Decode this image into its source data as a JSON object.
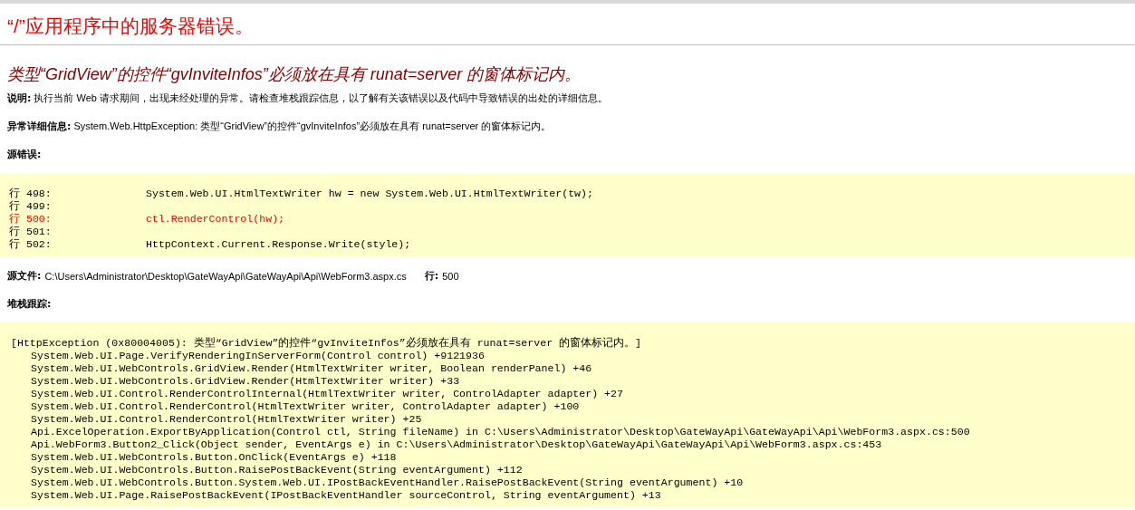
{
  "title": "“/”应用程序中的服务器错误。",
  "message": "类型“GridView”的控件“gvInviteInfos”必须放在具有 runat=server 的窗体标记内。",
  "description": {
    "label": "说明:",
    "text": "执行当前 Web 请求期间，出现未经处理的异常。请检查堆栈跟踪信息，以了解有关该错误以及代码中导致错误的出处的详细信息。"
  },
  "exception_details": {
    "label": "异常详细信息:",
    "text": "System.Web.HttpException: 类型“GridView”的控件“gvInviteInfos”必须放在具有 runat=server 的窗体标记内。"
  },
  "source_error": {
    "label": "源错误:",
    "lines": [
      {
        "number": "行 498:",
        "code": "System.Web.UI.HtmlTextWriter hw = new System.Web.UI.HtmlTextWriter(tw);",
        "highlighted": false
      },
      {
        "number": "行 499:",
        "highlighted": false
      },
      {
        "number": "行 500:",
        "code": "ctl.RenderControl(hw);",
        "highlighted": true
      },
      {
        "number": "行 501:",
        "highlighted": false
      },
      {
        "number": "行 502:",
        "code": "HttpContext.Current.Response.Write(style);",
        "highlighted": false
      }
    ]
  },
  "source_file": {
    "label": "源文件:",
    "path": "C:\\Users\\Administrator\\Desktop\\GateWayApi\\GateWayApi\\Api\\WebForm3.aspx.cs",
    "line_label": "行:",
    "line": "500"
  },
  "stack_trace": {
    "label": "堆栈跟踪:",
    "header": "[HttpException (0x80004005): 类型“GridView”的控件“gvInviteInfos”必须放在具有 runat=server 的窗体标记内。]",
    "frames": [
      "System.Web.UI.Page.VerifyRenderingInServerForm(Control control) +9121936",
      "System.Web.UI.WebControls.GridView.Render(HtmlTextWriter writer, Boolean renderPanel) +46",
      "System.Web.UI.WebControls.GridView.Render(HtmlTextWriter writer) +33",
      "System.Web.UI.Control.RenderControlInternal(HtmlTextWriter writer, ControlAdapter adapter) +27",
      "System.Web.UI.Control.RenderControl(HtmlTextWriter writer, ControlAdapter adapter) +100",
      "System.Web.UI.Control.RenderControl(HtmlTextWriter writer) +25",
      "Api.ExcelOperation.ExportByApplication(Control ctl, String fileName) in C:\\Users\\Administrator\\Desktop\\GateWayApi\\GateWayApi\\Api\\WebForm3.aspx.cs:500",
      "Api.WebForm3.Button2_Click(Object sender, EventArgs e) in C:\\Users\\Administrator\\Desktop\\GateWayApi\\GateWayApi\\Api\\WebForm3.aspx.cs:453",
      "System.Web.UI.WebControls.Button.OnClick(EventArgs e) +118",
      "System.Web.UI.WebControls.Button.RaisePostBackEvent(String eventArgument) +112",
      "System.Web.UI.WebControls.Button.System.Web.UI.IPostBackEventHandler.RaisePostBackEvent(String eventArgument) +10",
      "System.Web.UI.Page.RaisePostBackEvent(IPostBackEventHandler sourceControl, String eventArgument) +13"
    ]
  }
}
